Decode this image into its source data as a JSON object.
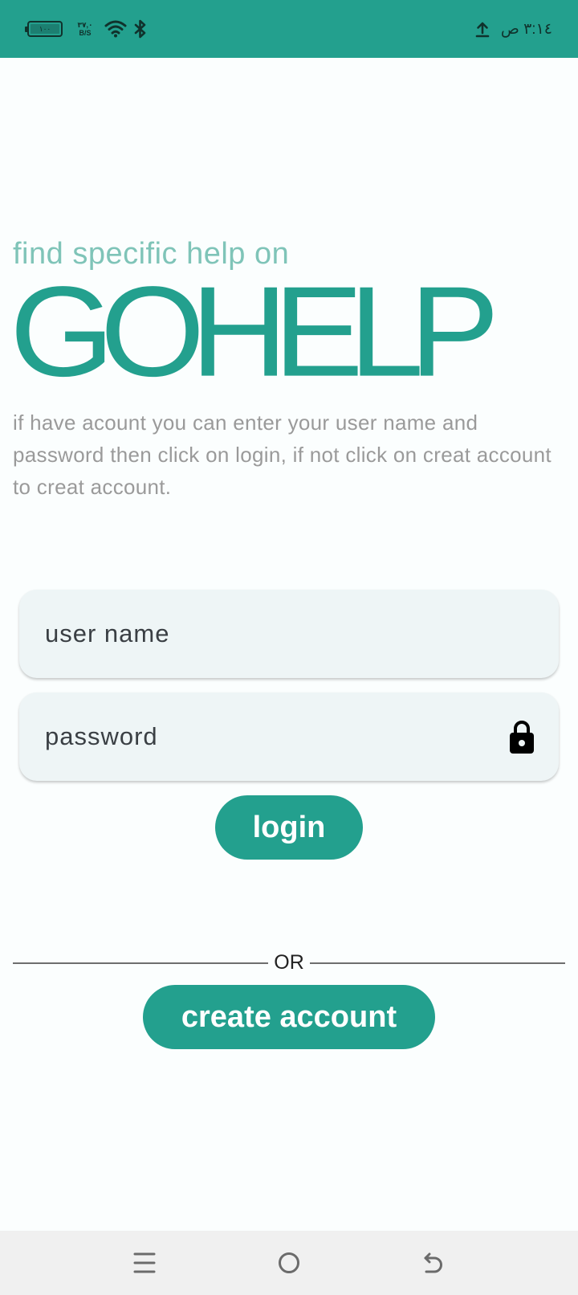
{
  "status_bar": {
    "battery_text": "١٠٠",
    "net_speed_value": "٣٧,٠",
    "net_speed_unit": "B/S",
    "time": "٣:١٤ ص",
    "icons": [
      "battery-icon",
      "wifi-icon",
      "bluetooth-icon",
      "upload-icon"
    ]
  },
  "header": {
    "tagline": "find specific help on",
    "logo": "GOHELP",
    "description": "if have acount you can enter your user name and password then click on login, if not click on creat account to creat account."
  },
  "form": {
    "username_placeholder": "user name",
    "password_placeholder": "password",
    "login_label": "login",
    "divider_label": "OR",
    "create_account_label": "create account"
  },
  "nav": {
    "icons": [
      "menu-icon",
      "home-icon",
      "back-icon"
    ]
  },
  "colors": {
    "accent": "#23a08e",
    "tagline": "#7fc4b8",
    "description": "#9a9a9a",
    "field_bg": "#eef5f6",
    "page_bg": "#fbfefe"
  }
}
